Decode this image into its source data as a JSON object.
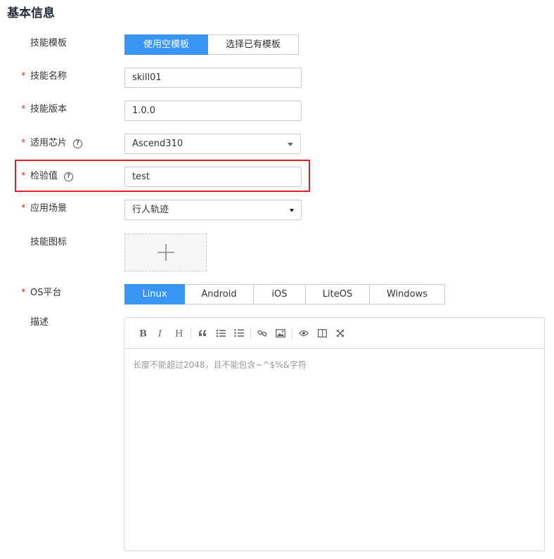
{
  "section": {
    "title": "基本信息"
  },
  "form": {
    "template": {
      "label": "技能模板",
      "options": [
        "使用空模板",
        "选择已有模板"
      ],
      "selected_index": 0
    },
    "name": {
      "label": "技能名称",
      "value": "skill01"
    },
    "version": {
      "label": "技能版本",
      "value": "1.0.0"
    },
    "chip": {
      "label": "适用芯片",
      "help": "?",
      "value": "Ascend310"
    },
    "check": {
      "label": "检验值",
      "help": "?",
      "value": "test"
    },
    "scenario": {
      "label": "应用场景",
      "value": "行人轨迹"
    },
    "icon": {
      "label": "技能图标"
    },
    "os": {
      "label": "OS平台",
      "options": [
        "Linux",
        "Android",
        "iOS",
        "LiteOS",
        "Windows"
      ],
      "selected_index": 0
    },
    "description": {
      "label": "描述",
      "placeholder": "长度不能超过2048，且不能包含~^$%&字符"
    }
  },
  "required_mark": "*",
  "colors": {
    "accent": "#3895f6",
    "required": "#e0281f",
    "highlight": "#e02020"
  }
}
